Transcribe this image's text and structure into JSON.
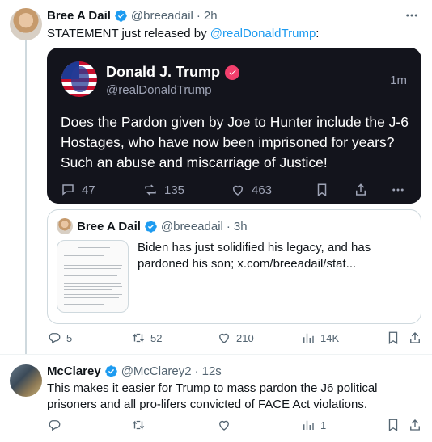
{
  "tweet1": {
    "author_name": "Bree A Dail",
    "author_handle": "@breeadail",
    "dot": "·",
    "time": "2h",
    "text_prefix": "STATEMENT just released by ",
    "mention": "@realDonaldTrump",
    "text_suffix": ":",
    "more_icon": "more-horizontal-icon",
    "truth_post": {
      "name": "Donald J. Trump",
      "handle": "@realDonaldTrump",
      "time": "1m",
      "text": "Does the Pardon given by Joe to Hunter include the J-6 Hostages, who have now been imprisoned for years? Such an abuse and miscarriage of Justice!",
      "replies": "47",
      "retruths": "135",
      "likes": "463"
    },
    "quote": {
      "author_name": "Bree A Dail",
      "author_handle": "@breeadail",
      "dot": "·",
      "time": "3h",
      "text": "Biden has just solidified his legacy, and has pardoned his son;  x.com/breeadail/stat..."
    },
    "metrics": {
      "replies": "5",
      "reposts": "52",
      "likes": "210",
      "views": "14K"
    }
  },
  "tweet2": {
    "author_name": "McClarey",
    "author_handle": "@McClarey2",
    "dot": "·",
    "time": "12s",
    "text": "This makes it easier for Trump to mass pardon the J6 political prisoners and all pro-lifers convicted of FACE Act violations.",
    "metrics": {
      "views": "1"
    }
  },
  "colors": {
    "accent": "#1d9bf0",
    "muted": "#536471",
    "truth_bg": "#13141c",
    "truth_badge": "#f23f6c"
  }
}
